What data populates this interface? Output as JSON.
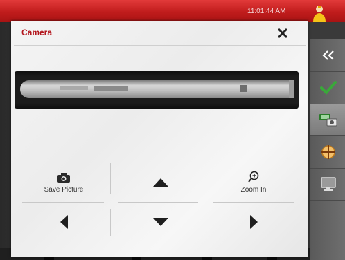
{
  "status_bar": {
    "time": "11:01:44 AM"
  },
  "dialog": {
    "title": "Camera",
    "controls": {
      "save_picture": "Save Picture",
      "zoom_in": "Zoom In"
    }
  },
  "sidebar": {
    "items": [
      {
        "icon": "double-chevron-left-icon"
      },
      {
        "icon": "checkmark-icon"
      },
      {
        "icon": "camera-transfer-icon",
        "active": true
      },
      {
        "icon": "target-icon"
      },
      {
        "icon": "monitor-icon"
      }
    ]
  },
  "colors": {
    "brand_red": "#c01c1c",
    "title_red": "#b3161d",
    "check_green": "#3aa83a"
  }
}
